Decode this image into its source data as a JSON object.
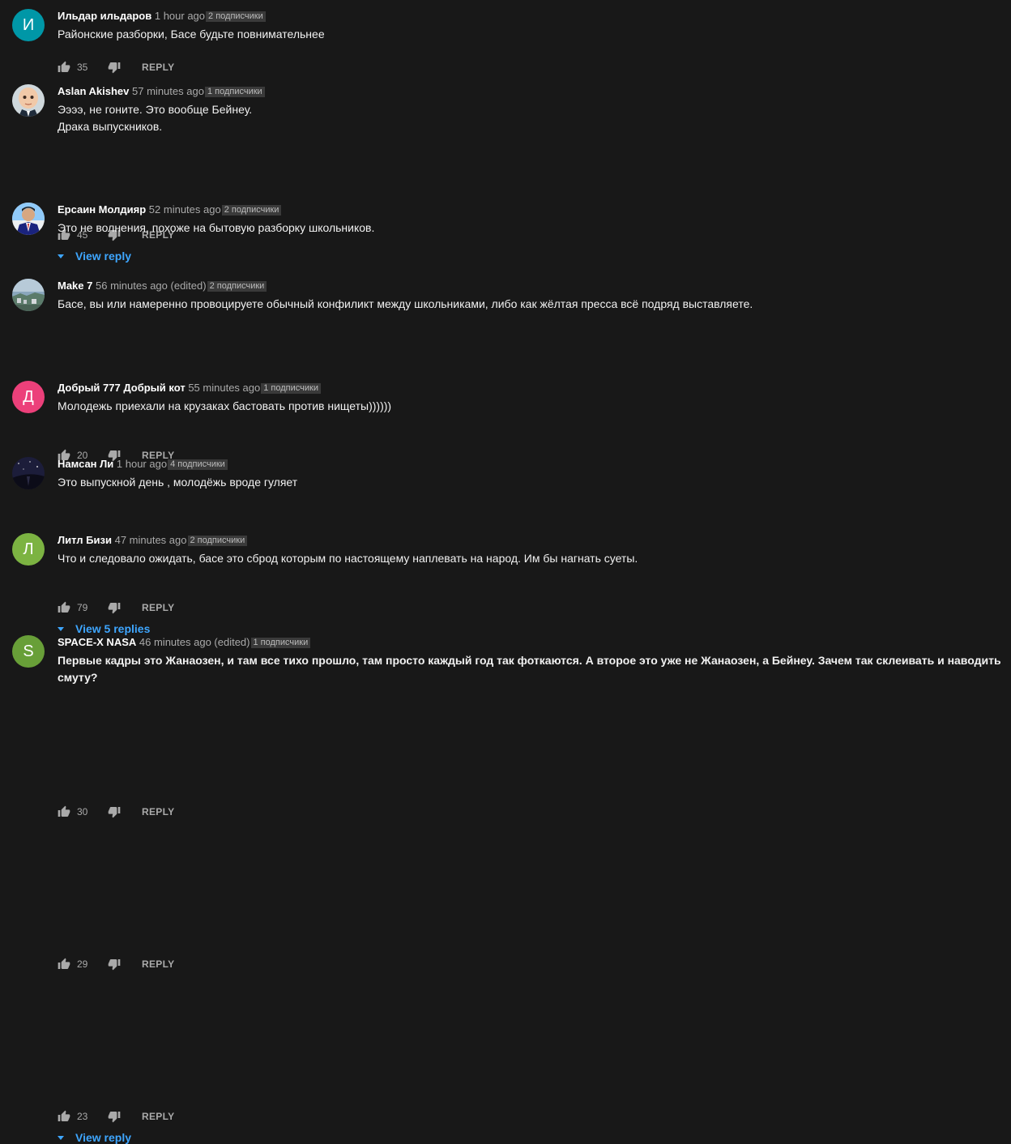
{
  "ui": {
    "reply_label": "REPLY"
  },
  "comments": [
    {
      "author": "Ильдар ильдаров",
      "time": "1 hour ago",
      "subs": "2 подписчики",
      "text": "Районские разборки, Басе будьте повнимательнее",
      "likes": "35",
      "avatar": {
        "kind": "letter",
        "letter": "И",
        "color": "#0097a7"
      }
    },
    {
      "author": "Aslan Akishev",
      "time": "57 minutes ago",
      "subs": "1 подписчики",
      "text": "Ээээ, не гоните. Это вообще Бейнеу.\nДрака выпускников.",
      "likes": "45",
      "view_replies": "View reply",
      "avatar": {
        "kind": "photo",
        "icon": "baby-boss-photo-icon"
      }
    },
    {
      "author": "Ерсаин Молдияр",
      "time": "52 minutes ago",
      "subs": "2 подписчики",
      "text": "Это не волнения, похоже на бытовую разборку школьников.",
      "likes": "20",
      "avatar": {
        "kind": "photo",
        "icon": "man-in-suit-photo-icon"
      }
    },
    {
      "author": "Make 7",
      "time": "56 minutes ago (edited)",
      "subs": "2 подписчики",
      "text": "Басе, вы или намеренно провоцируете обычный конфиликт между школьниками, либо как жёлтая пресса всё подряд выставляете.",
      "likes": "79",
      "view_replies": "View 5 replies",
      "avatar": {
        "kind": "photo",
        "icon": "landscape-photo-icon"
      }
    },
    {
      "author": "Добрый 777 Добрый кот",
      "time": "55 minutes ago",
      "subs": "1 подписчики",
      "text": "Молодежь приехали на крузаках бастовать против нищеты))))))",
      "likes": "30",
      "avatar": {
        "kind": "letter",
        "letter": "Д",
        "color": "#ec407a"
      }
    },
    {
      "author": "Намсан Ли",
      "time": "1 hour ago",
      "subs": "4 подписчики",
      "text": "Это выпускной день , молодёжь вроде гуляет",
      "likes": "29",
      "avatar": {
        "kind": "photo",
        "icon": "night-sky-photo-icon"
      }
    },
    {
      "author": "Литл Бизи",
      "time": "47 minutes ago",
      "subs": "2 подписчики",
      "text": "Что и следовало ожидать, басе это сброд которым по настоящему наплевать на народ. Им бы нагнать суеты.",
      "likes": "23",
      "view_replies": "View reply",
      "avatar": {
        "kind": "letter",
        "letter": "Л",
        "color": "#7cb342"
      }
    },
    {
      "author": "SPACE-X NASA",
      "time": "46 minutes ago (edited)",
      "subs": "1 подписчики",
      "text": "Первые кадры это Жанаозен, и там все тихо прошло, там просто каждый год так фоткаются. А второе это уже не Жанаозен, а Бейнеу. Зачем так склеивать и наводить смуту?",
      "bold_text": true,
      "avatar": {
        "kind": "letter",
        "letter": "S",
        "color": "#689f38"
      }
    }
  ]
}
